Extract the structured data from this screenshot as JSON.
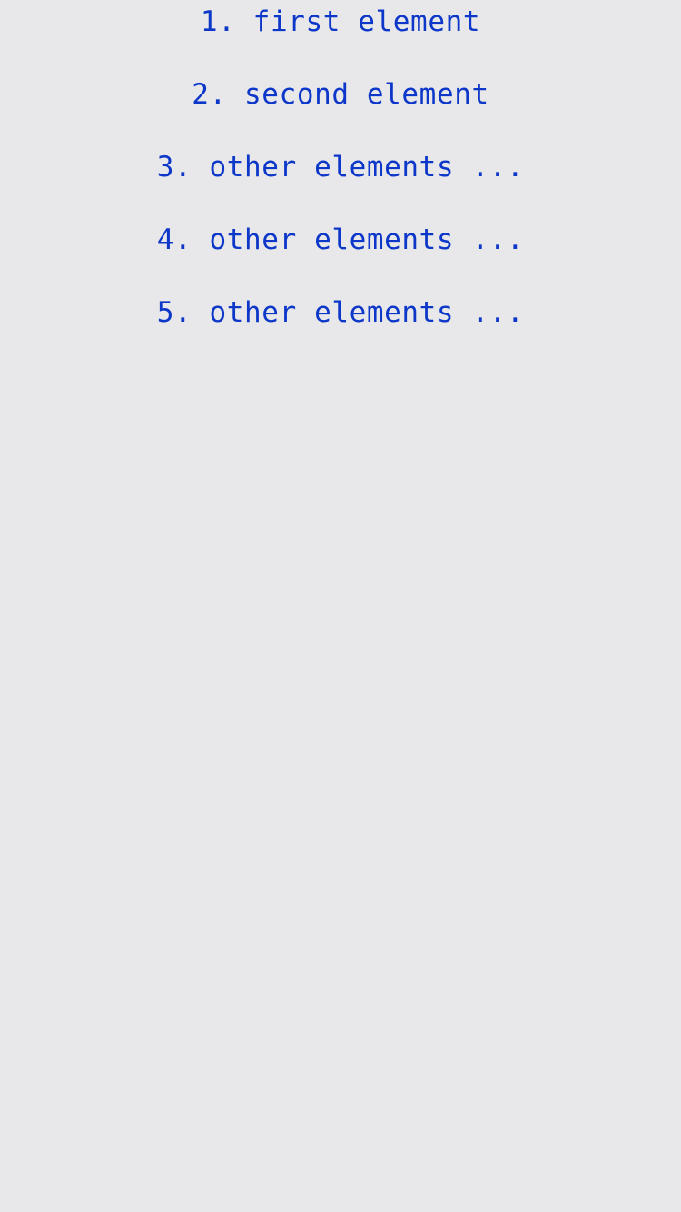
{
  "list": {
    "items": [
      {
        "label": "1. first element"
      },
      {
        "label": "2. second element"
      },
      {
        "label": "3. other elements ..."
      },
      {
        "label": "4. other elements ..."
      },
      {
        "label": "5. other elements ..."
      }
    ]
  },
  "colors": {
    "background": "#e8e8ea",
    "text": "#0c37c8"
  }
}
